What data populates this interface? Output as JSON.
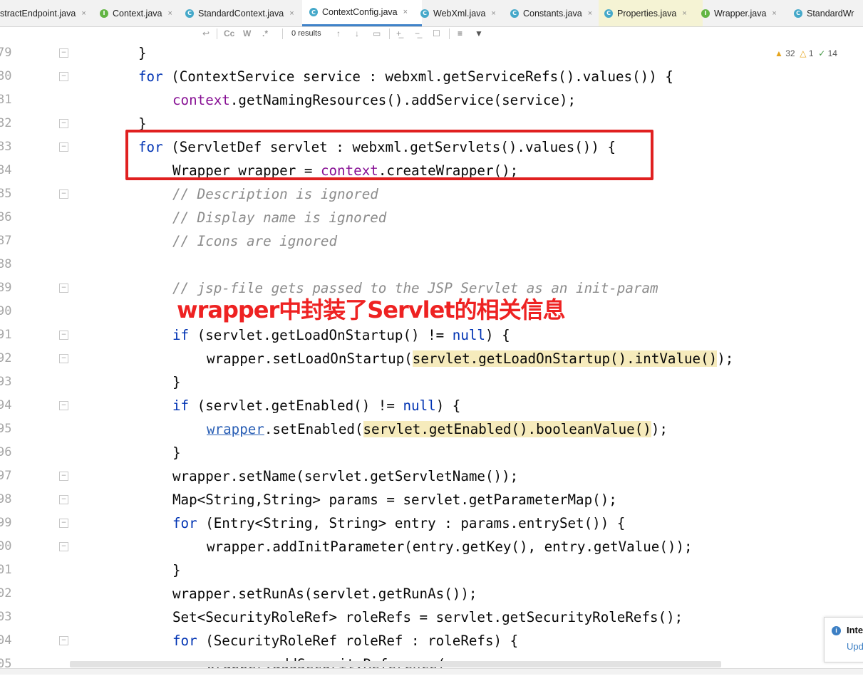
{
  "tabs": [
    {
      "label": "stractEndpoint.java",
      "icon": "none",
      "active": false
    },
    {
      "label": "Context.java",
      "icon": "I",
      "active": false
    },
    {
      "label": "StandardContext.java",
      "icon": "C",
      "active": false
    },
    {
      "label": "ContextConfig.java",
      "icon": "C",
      "active": true
    },
    {
      "label": "WebXml.java",
      "icon": "C",
      "active": false
    },
    {
      "label": "Constants.java",
      "icon": "C",
      "active": false
    },
    {
      "label": "Properties.java",
      "icon": "C",
      "active": false
    },
    {
      "label": "Wrapper.java",
      "icon": "I",
      "active": false
    },
    {
      "label": "StandardWr",
      "icon": "C",
      "active": false
    }
  ],
  "tab_close_glyph": "×",
  "find": {
    "case_label": "Cc",
    "word_label": "W",
    "regex_label": ".*",
    "results": "0 results"
  },
  "inspections": {
    "warnings": "32",
    "weak_warnings": "1",
    "typos": "14"
  },
  "line_numbers": [
    "79",
    "80",
    "81",
    "82",
    "83",
    "84",
    "85",
    "86",
    "87",
    "88",
    "89",
    "90",
    "91",
    "92",
    "93",
    "94",
    "95",
    "96",
    "97",
    "98",
    "99",
    "00",
    "01",
    "02",
    "03",
    "04",
    "05"
  ],
  "annotation": "wrapper中封装了Servlet的相关信息",
  "notification": {
    "title": "Inte",
    "link": "Upd"
  },
  "colors": {
    "keyword": "#0033b3",
    "field": "#871094",
    "comment": "#8c8c8c",
    "highlight_box": "#e02020",
    "annotation": "#ee2222"
  }
}
